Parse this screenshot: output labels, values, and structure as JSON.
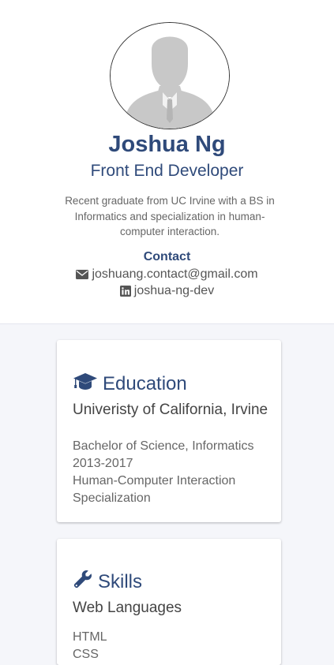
{
  "profile": {
    "name": "Joshua Ng",
    "title": "Front End Developer",
    "summary": "Recent graduate from UC Irvine with a BS in Informatics and specialization in human-computer interaction.",
    "contact_heading": "Contact",
    "email": "joshuang.contact@gmail.com",
    "linkedin": "joshua-ng-dev",
    "avatar_icon": "person-silhouette-icon",
    "email_icon": "envelope-icon",
    "linkedin_icon": "linkedin-icon"
  },
  "education": {
    "heading": "Education",
    "icon": "graduation-cap-icon",
    "school": "Univeristy of California, Irvine",
    "details": [
      "Bachelor of Science, Informatics",
      "2013-2017",
      "Human-Computer Interaction Specialization"
    ]
  },
  "skills": {
    "heading": "Skills",
    "icon": "wrench-icon",
    "group_title": "Web Languages",
    "items": [
      "HTML",
      "CSS"
    ]
  },
  "colors": {
    "accent": "#2f4a7a",
    "page_background": "#f5f6fa",
    "card_background": "#ffffff",
    "text": "#555555"
  }
}
